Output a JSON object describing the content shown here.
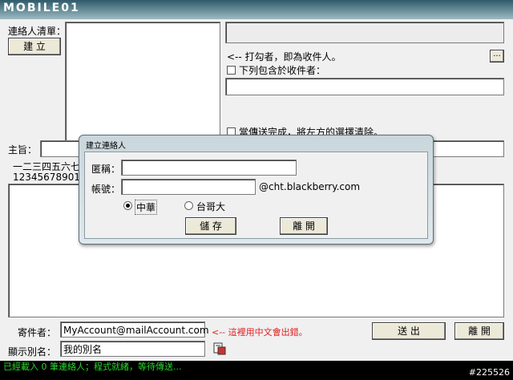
{
  "window": {
    "logo_text": "MOBILE01"
  },
  "contacts": {
    "label": "連絡人清單：",
    "create_button": "建 立"
  },
  "recipients": {
    "browse_button": "...",
    "hint": "<-- 打勾者，即為收件人。",
    "include_label": "下列包含於收件者：",
    "include_value": "",
    "clear_label": "當傳送完成，將左方的選擇清除。"
  },
  "subject": {
    "label": "主旨：",
    "value": "",
    "preview_line1": "一二三四五六七",
    "preview_line2": "123456789012"
  },
  "message": {
    "body": ""
  },
  "sender": {
    "label": "寄件者：",
    "value": "MyAccount@mailAccount.com",
    "warning": "<-- 這裡用中文會出錯。",
    "alias_label": "顯示別名：",
    "alias_value": "我的別名",
    "send_button": "送 出",
    "exit_button": "離 開"
  },
  "status_text": "已經載入 0 筆連絡人；程式就緒，等待傳送...",
  "watermark": "#225526",
  "dialog": {
    "title": "建立連絡人",
    "name_label": "匿稱：",
    "name_value": "",
    "account_label": "帳號：",
    "account_value": "",
    "domain_suffix": "@cht.blackberry.com",
    "carrier_options": [
      "中華",
      "台哥大"
    ],
    "carrier_selected": "中華",
    "save_button": "儲 存",
    "close_button": "離 開"
  }
}
